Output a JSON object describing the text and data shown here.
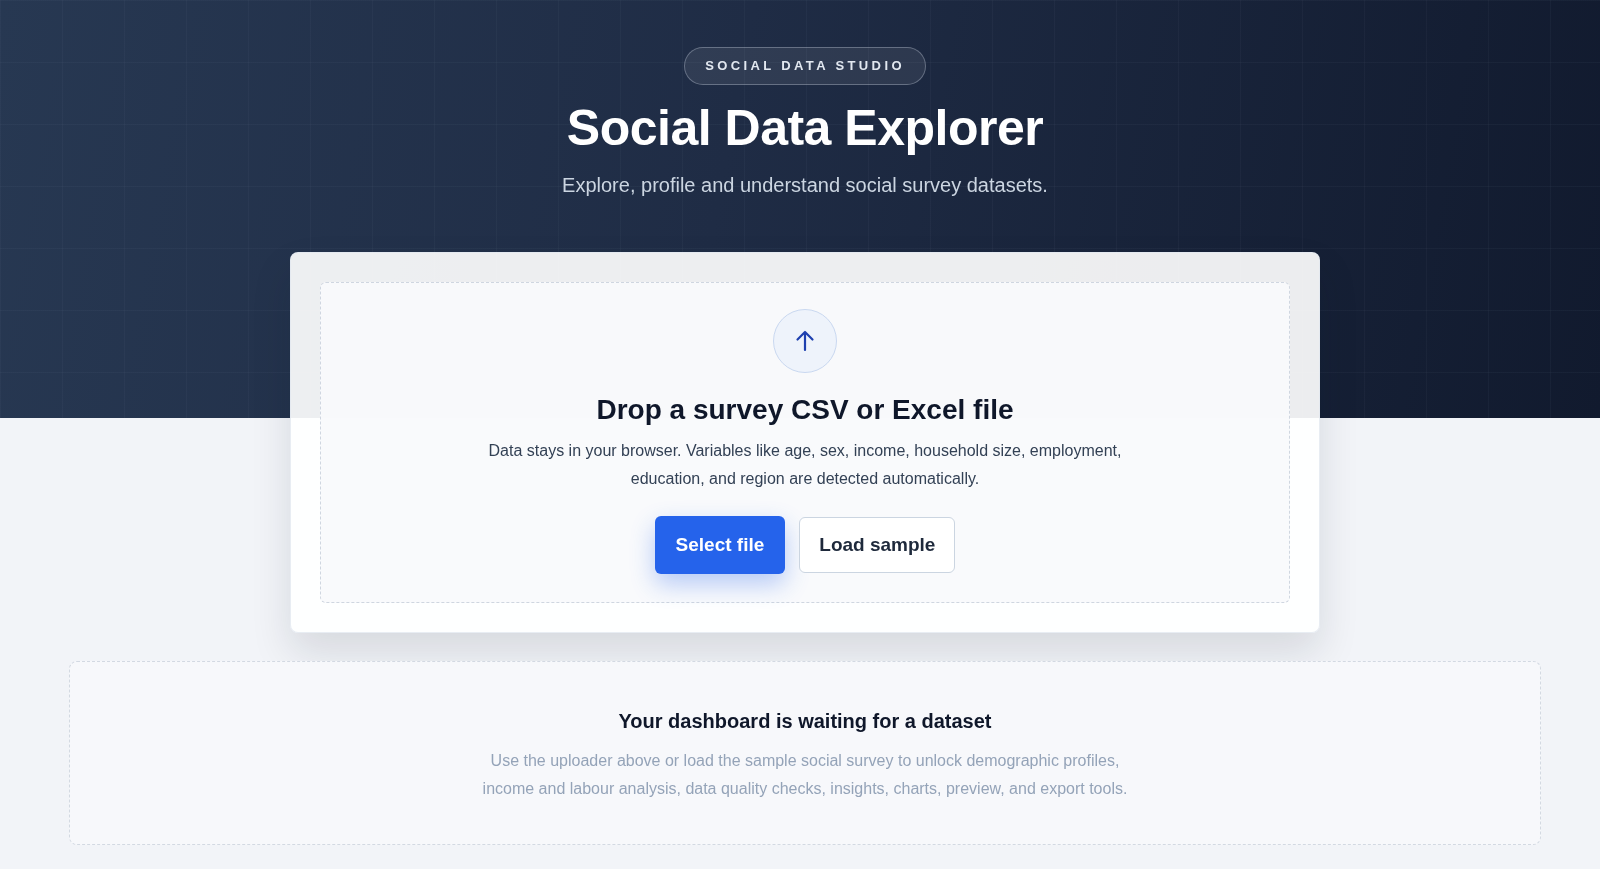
{
  "header": {
    "badge": "SOCIAL DATA STUDIO",
    "title": "Social Data Explorer",
    "subtitle": "Explore, profile and understand social survey datasets."
  },
  "uploader": {
    "heading": "Drop a survey CSV or Excel file",
    "description": "Data stays in your browser. Variables like age, sex, income, household size, employment, education, and region are detected automatically.",
    "buttons": [
      {
        "label": "Select file",
        "kind": "primary"
      },
      {
        "label": "Load sample",
        "kind": "secondary"
      }
    ]
  },
  "empty_state": {
    "title": "Your dashboard is waiting for a dataset",
    "message": "Use the uploader above or load the sample social survey to unlock demographic profiles, income and labour analysis, data quality checks, insights, charts, preview, and export tools."
  }
}
